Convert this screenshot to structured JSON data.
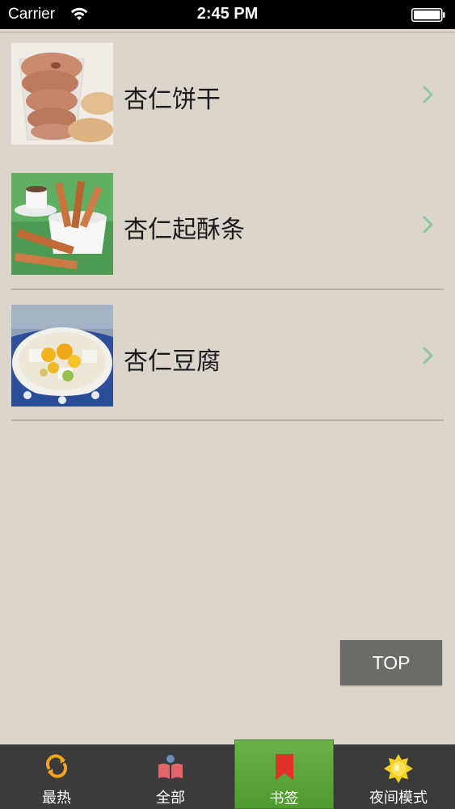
{
  "status_bar": {
    "carrier": "Carrier",
    "time": "2:45 PM",
    "wifi_icon": "wifi-icon",
    "battery_icon": "battery-full-icon"
  },
  "list": {
    "items": [
      {
        "title": "杏仁饼干",
        "thumbnail": "almond-cookies-photo",
        "chevron": "chevron-right-icon"
      },
      {
        "title": "杏仁起酥条",
        "thumbnail": "almond-pastry-sticks-photo",
        "chevron": "chevron-right-icon"
      },
      {
        "title": "杏仁豆腐",
        "thumbnail": "almond-tofu-photo",
        "chevron": "chevron-right-icon"
      }
    ]
  },
  "top_button": {
    "label": "TOP"
  },
  "tab_bar": {
    "active_index": 2,
    "active_color": "#5aa63a",
    "tabs": [
      {
        "label": "最热",
        "icon": "refresh-icon"
      },
      {
        "label": "全部",
        "icon": "book-icon"
      },
      {
        "label": "书签",
        "icon": "bookmark-icon"
      },
      {
        "label": "夜间模式",
        "icon": "sun-icon"
      }
    ]
  },
  "colors": {
    "background": "#dbd5cb",
    "chevron": "#8fc99a",
    "tab_bar": "#3b3b3b"
  }
}
